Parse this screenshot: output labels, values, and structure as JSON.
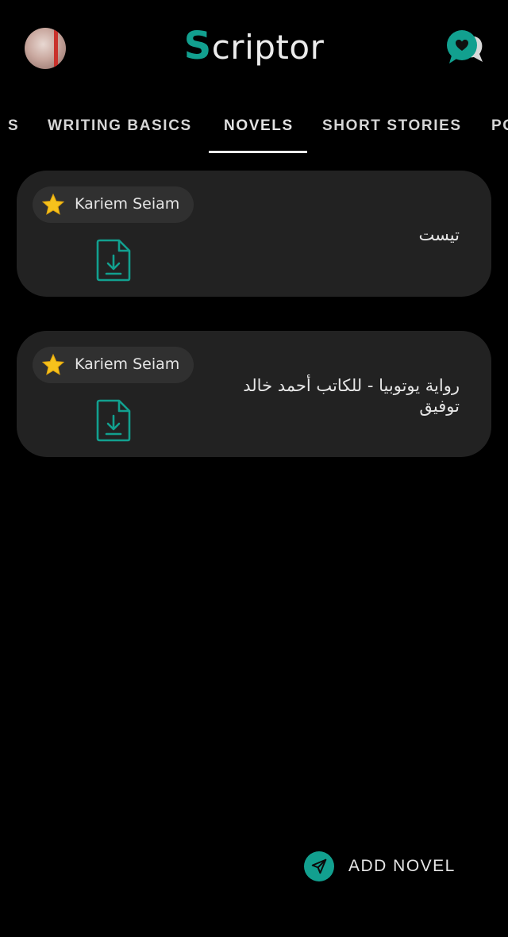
{
  "app": {
    "title_first_letter": "S",
    "title_rest": "criptor",
    "accent_color": "#12a08f"
  },
  "header": {
    "avatar_icon": "user-avatar",
    "chat_icon": "chat-heart-icon"
  },
  "tabs": [
    {
      "label": "S",
      "active": false
    },
    {
      "label": "WRITING BASICS",
      "active": false
    },
    {
      "label": "NOVELS",
      "active": true
    },
    {
      "label": "SHORT STORIES",
      "active": false
    },
    {
      "label": "PO",
      "active": false
    }
  ],
  "novels": [
    {
      "author": "Kariem Seiam",
      "title": "تيست",
      "star_icon": "star-icon",
      "download_icon": "file-download-icon"
    },
    {
      "author": "Kariem Seiam",
      "title": "رواية يوتوبيا - للكاتب أحمد خالد توفيق",
      "star_icon": "star-icon",
      "download_icon": "file-download-icon"
    }
  ],
  "fab": {
    "label": "ADD NOVEL",
    "icon": "send-icon"
  }
}
